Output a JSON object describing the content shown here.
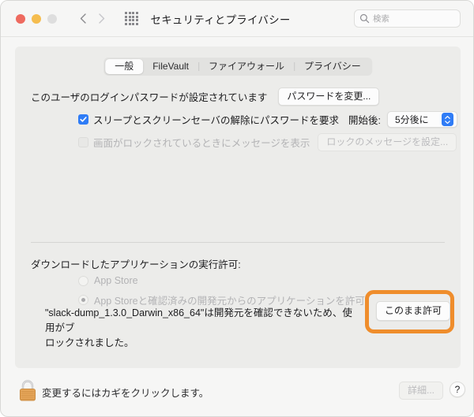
{
  "window": {
    "title": "セキュリティとプライバシー",
    "traffic_lights": [
      "close-red",
      "minimize-yellow",
      "zoom-gray-disabled"
    ],
    "nav": {
      "back_icon": "chevron-left-icon",
      "forward_icon": "chevron-right-icon"
    },
    "grid_icon": "show-all-grid-icon",
    "search": {
      "placeholder": "検索",
      "value": "",
      "icon": "search-icon"
    }
  },
  "tabs": [
    {
      "label": "一般",
      "selected": true
    },
    {
      "label": "FileVault",
      "selected": false
    },
    {
      "label": "ファイアウォール",
      "selected": false
    },
    {
      "label": "プライバシー",
      "selected": false
    }
  ],
  "general": {
    "password_status": "このユーザのログインパスワードが設定されています",
    "change_password_button": "パスワードを変更...",
    "require_password": {
      "label": "スリープとスクリーンセーバの解除にパスワードを要求",
      "checked": true,
      "delay_label": "開始後:",
      "delay_value": "5分後に"
    },
    "show_message": {
      "label": "画面がロックされているときにメッセージを表示",
      "checked": false,
      "disabled": true,
      "set_message_button": "ロックのメッセージを設定..."
    }
  },
  "gatekeeper": {
    "heading": "ダウンロードしたアプリケーションの実行許可:",
    "options": [
      {
        "label": "App Store",
        "selected": false,
        "disabled": true
      },
      {
        "label": "App Storeと確認済みの開発元からのアプリケーションを許可",
        "selected": true,
        "disabled": true
      }
    ],
    "blocked_notice_line1": "\"slack-dump_1.3.0_Darwin_x86_64\"は開発元を確認できないため、使用がブ",
    "blocked_notice_line2": "ロックされました。",
    "allow_anyway_button": "このまま許可",
    "highlight_color": "#ef8d2c"
  },
  "footer": {
    "lock_icon": "lock-closed-icon",
    "lock_text": "変更するにはカギをクリックします。",
    "advanced_button": "詳細...",
    "help_button": "?"
  },
  "colors": {
    "accent_blue": "#2f7cf6",
    "highlight_orange": "#ef8d2c",
    "window_bg": "#f6f6f5",
    "panel_bg": "#ececea"
  }
}
